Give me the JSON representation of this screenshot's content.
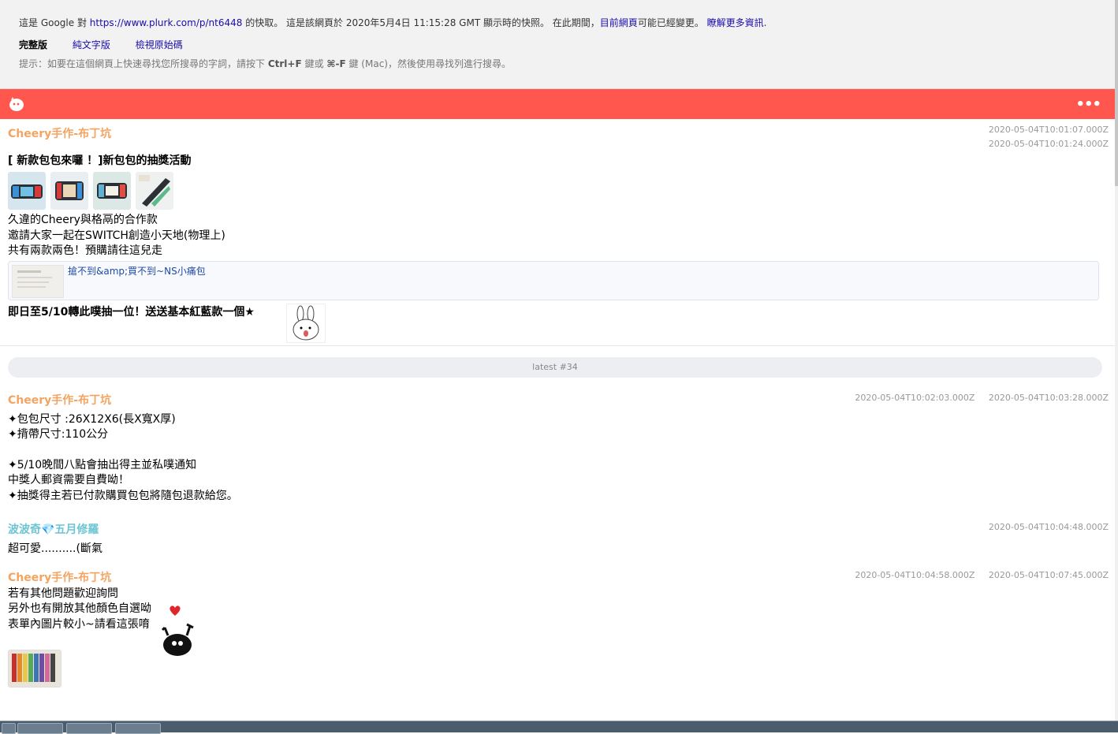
{
  "cache": {
    "pre": "這是 Google 對",
    "url": "https://www.plurk.com/p/nt6448",
    "mid": "的快取。 這是該網頁於 2020年5月4日 11:15:28 GMT 顯示時的快照。 在此期間，",
    "current_page": "目前網頁",
    "post": "可能已經變更。",
    "learn_more": "瞭解更多資訊",
    "links": {
      "full": "完整版",
      "text_only": "純文字版",
      "view_source": "檢視原始碼"
    },
    "tip_pre": "提示：如要在這個網頁上快速尋找您所搜尋的字詞，請按下",
    "tip_key1": "Ctrl+F",
    "tip_mid": "鍵或",
    "tip_key2": "⌘-F",
    "tip_post": "鍵 (Mac)，然後使用尋找列進行搜尋。"
  },
  "header": {
    "more_label": "•••"
  },
  "posts": [
    {
      "author": "Cheery手作-布丁坑",
      "timestamps": [
        "2020-05-04T10:01:07.000Z",
        "2020-05-04T10:01:24.000Z"
      ],
      "title": "[ 新款包包來囉 ！]新包包的抽獎活動",
      "lines": [
        "久違的Cheery與格鬲的合作款",
        "邀請大家一起在SWITCH創造小天地(物理上)",
        "共有兩款兩色！預購請往這兒走"
      ],
      "link_title": "搶不到&amp;買不到~NS小痛包",
      "footer": "即日至5/10轉此噗抽一位！送送基本紅藍款一個★"
    }
  ],
  "latest_label": "latest #34",
  "responses": [
    {
      "author": "Cheery手作-布丁坑",
      "timestamps": [
        "2020-05-04T10:02:03.000Z",
        "2020-05-04T10:03:28.000Z"
      ],
      "lines": [
        "✦包包尺寸 :26X12X6(長X寬X厚)",
        "✦揹帶尺寸:110公分",
        "",
        "✦5/10晚間八點會抽出得主並私噗通知",
        "中獎人郵資需要自費呦！",
        "✦抽獎得主若已付款購買包包將隨包退款給您。"
      ]
    },
    {
      "author": "波波奇💎五月修羅",
      "timestamps": [
        "2020-05-04T10:04:48.000Z"
      ],
      "lines": [
        "超可愛..........(斷氣"
      ]
    },
    {
      "author": "Cheery手作-布丁坑",
      "timestamps": [
        "2020-05-04T10:04:58.000Z",
        "2020-05-04T10:07:45.000Z"
      ],
      "lines": [
        "若有其他問題歡迎詢問",
        "另外也有開放其他顏色自選呦",
        "表單內圖片較小~請看這張唷"
      ]
    }
  ],
  "colors": {
    "header": "#ff574d",
    "author": "#f4a460",
    "author_alt": "#6cc5d3",
    "link": "#1a0dab"
  }
}
